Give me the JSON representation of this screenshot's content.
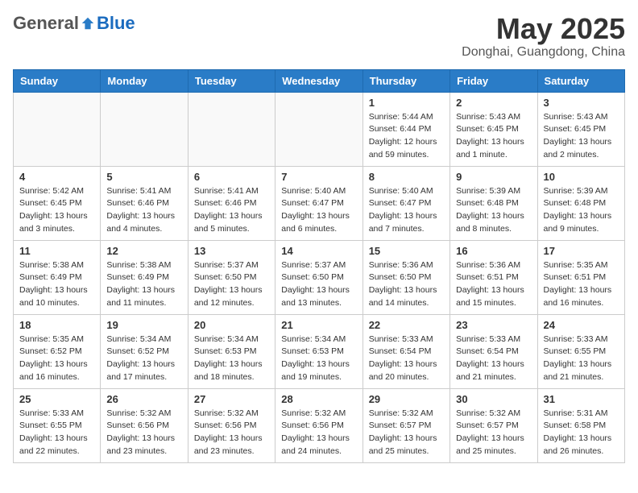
{
  "header": {
    "logo_general": "General",
    "logo_blue": "Blue",
    "month_title": "May 2025",
    "location": "Donghai, Guangdong, China"
  },
  "weekdays": [
    "Sunday",
    "Monday",
    "Tuesday",
    "Wednesday",
    "Thursday",
    "Friday",
    "Saturday"
  ],
  "weeks": [
    [
      {
        "day": "",
        "info": ""
      },
      {
        "day": "",
        "info": ""
      },
      {
        "day": "",
        "info": ""
      },
      {
        "day": "",
        "info": ""
      },
      {
        "day": "1",
        "info": "Sunrise: 5:44 AM\nSunset: 6:44 PM\nDaylight: 12 hours\nand 59 minutes."
      },
      {
        "day": "2",
        "info": "Sunrise: 5:43 AM\nSunset: 6:45 PM\nDaylight: 13 hours\nand 1 minute."
      },
      {
        "day": "3",
        "info": "Sunrise: 5:43 AM\nSunset: 6:45 PM\nDaylight: 13 hours\nand 2 minutes."
      }
    ],
    [
      {
        "day": "4",
        "info": "Sunrise: 5:42 AM\nSunset: 6:45 PM\nDaylight: 13 hours\nand 3 minutes."
      },
      {
        "day": "5",
        "info": "Sunrise: 5:41 AM\nSunset: 6:46 PM\nDaylight: 13 hours\nand 4 minutes."
      },
      {
        "day": "6",
        "info": "Sunrise: 5:41 AM\nSunset: 6:46 PM\nDaylight: 13 hours\nand 5 minutes."
      },
      {
        "day": "7",
        "info": "Sunrise: 5:40 AM\nSunset: 6:47 PM\nDaylight: 13 hours\nand 6 minutes."
      },
      {
        "day": "8",
        "info": "Sunrise: 5:40 AM\nSunset: 6:47 PM\nDaylight: 13 hours\nand 7 minutes."
      },
      {
        "day": "9",
        "info": "Sunrise: 5:39 AM\nSunset: 6:48 PM\nDaylight: 13 hours\nand 8 minutes."
      },
      {
        "day": "10",
        "info": "Sunrise: 5:39 AM\nSunset: 6:48 PM\nDaylight: 13 hours\nand 9 minutes."
      }
    ],
    [
      {
        "day": "11",
        "info": "Sunrise: 5:38 AM\nSunset: 6:49 PM\nDaylight: 13 hours\nand 10 minutes."
      },
      {
        "day": "12",
        "info": "Sunrise: 5:38 AM\nSunset: 6:49 PM\nDaylight: 13 hours\nand 11 minutes."
      },
      {
        "day": "13",
        "info": "Sunrise: 5:37 AM\nSunset: 6:50 PM\nDaylight: 13 hours\nand 12 minutes."
      },
      {
        "day": "14",
        "info": "Sunrise: 5:37 AM\nSunset: 6:50 PM\nDaylight: 13 hours\nand 13 minutes."
      },
      {
        "day": "15",
        "info": "Sunrise: 5:36 AM\nSunset: 6:50 PM\nDaylight: 13 hours\nand 14 minutes."
      },
      {
        "day": "16",
        "info": "Sunrise: 5:36 AM\nSunset: 6:51 PM\nDaylight: 13 hours\nand 15 minutes."
      },
      {
        "day": "17",
        "info": "Sunrise: 5:35 AM\nSunset: 6:51 PM\nDaylight: 13 hours\nand 16 minutes."
      }
    ],
    [
      {
        "day": "18",
        "info": "Sunrise: 5:35 AM\nSunset: 6:52 PM\nDaylight: 13 hours\nand 16 minutes."
      },
      {
        "day": "19",
        "info": "Sunrise: 5:34 AM\nSunset: 6:52 PM\nDaylight: 13 hours\nand 17 minutes."
      },
      {
        "day": "20",
        "info": "Sunrise: 5:34 AM\nSunset: 6:53 PM\nDaylight: 13 hours\nand 18 minutes."
      },
      {
        "day": "21",
        "info": "Sunrise: 5:34 AM\nSunset: 6:53 PM\nDaylight: 13 hours\nand 19 minutes."
      },
      {
        "day": "22",
        "info": "Sunrise: 5:33 AM\nSunset: 6:54 PM\nDaylight: 13 hours\nand 20 minutes."
      },
      {
        "day": "23",
        "info": "Sunrise: 5:33 AM\nSunset: 6:54 PM\nDaylight: 13 hours\nand 21 minutes."
      },
      {
        "day": "24",
        "info": "Sunrise: 5:33 AM\nSunset: 6:55 PM\nDaylight: 13 hours\nand 21 minutes."
      }
    ],
    [
      {
        "day": "25",
        "info": "Sunrise: 5:33 AM\nSunset: 6:55 PM\nDaylight: 13 hours\nand 22 minutes."
      },
      {
        "day": "26",
        "info": "Sunrise: 5:32 AM\nSunset: 6:56 PM\nDaylight: 13 hours\nand 23 minutes."
      },
      {
        "day": "27",
        "info": "Sunrise: 5:32 AM\nSunset: 6:56 PM\nDaylight: 13 hours\nand 23 minutes."
      },
      {
        "day": "28",
        "info": "Sunrise: 5:32 AM\nSunset: 6:56 PM\nDaylight: 13 hours\nand 24 minutes."
      },
      {
        "day": "29",
        "info": "Sunrise: 5:32 AM\nSunset: 6:57 PM\nDaylight: 13 hours\nand 25 minutes."
      },
      {
        "day": "30",
        "info": "Sunrise: 5:32 AM\nSunset: 6:57 PM\nDaylight: 13 hours\nand 25 minutes."
      },
      {
        "day": "31",
        "info": "Sunrise: 5:31 AM\nSunset: 6:58 PM\nDaylight: 13 hours\nand 26 minutes."
      }
    ]
  ]
}
